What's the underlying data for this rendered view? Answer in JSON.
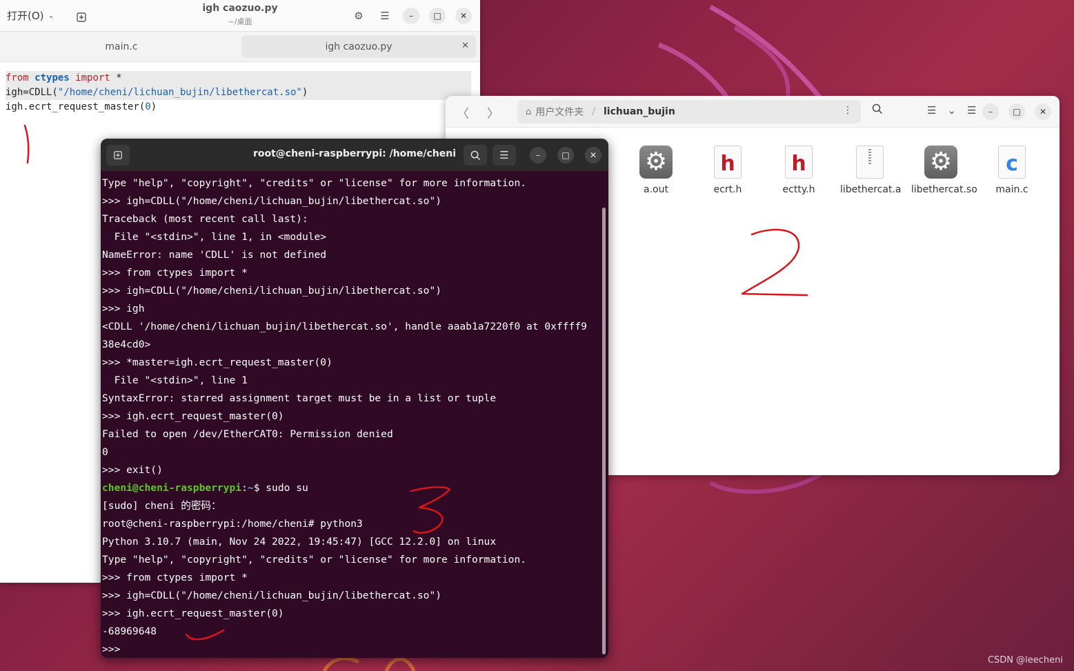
{
  "editor": {
    "open_menu_label": "打开(O)",
    "title": "igh caozuo.py",
    "subtitle": "~/桌面",
    "tabs": [
      {
        "label": "main.c"
      },
      {
        "label": "igh caozuo.py"
      }
    ],
    "code": {
      "line1": {
        "kw1": "from",
        "module": "ctypes",
        "kw2": "import",
        "rest": "*"
      },
      "line2": {
        "pre": "igh=CDLL(",
        "string": "\"/home/cheni/lichuan_bujin/libethercat.so\"",
        "post": ")"
      },
      "line3": {
        "pre": "igh.ecrt_request_master(",
        "num": "0",
        "post": ")"
      }
    }
  },
  "files": {
    "path_home": "用户文件夹",
    "path_current": "lichuan_bujin",
    "items": [
      {
        "name": "a.out",
        "icon": "executable-gear-icon"
      },
      {
        "name": "ecrt.h",
        "icon": "header-h-icon"
      },
      {
        "name": "ectty.h",
        "icon": "header-h-icon"
      },
      {
        "name": "libethercat.a",
        "icon": "archive-zip-icon"
      },
      {
        "name": "libethercat.so",
        "icon": "shared-library-gear-icon"
      },
      {
        "name": "main.c",
        "icon": "c-source-icon"
      }
    ],
    "item_letters": {
      "h": "h",
      "c": "c"
    }
  },
  "terminal": {
    "title": "root@cheni-raspberrypi: /home/cheni",
    "lines": [
      "Type \"help\", \"copyright\", \"credits\" or \"license\" for more information.",
      ">>> igh=CDLL(\"/home/cheni/lichuan_bujin/libethercat.so\")",
      "Traceback (most recent call last):",
      "  File \"<stdin>\", line 1, in <module>",
      "NameError: name 'CDLL' is not defined",
      ">>> from ctypes import *",
      ">>> igh=CDLL(\"/home/cheni/lichuan_bujin/libethercat.so\")",
      ">>> igh",
      "<CDLL '/home/cheni/lichuan_bujin/libethercat.so', handle aaab1a7220f0 at 0xffff9",
      "38e4cd0>",
      ">>> *master=igh.ecrt_request_master(0)",
      "  File \"<stdin>\", line 1",
      "SyntaxError: starred assignment target must be in a list or tuple",
      ">>> igh.ecrt_request_master(0)",
      "Failed to open /dev/EtherCAT0: Permission denied",
      "0",
      ">>> exit()"
    ],
    "prompt_user": "cheni@cheni-raspberrypi",
    "prompt_sep": ":",
    "prompt_path": "~",
    "prompt_cmd": "$ sudo su",
    "lines2": [
      "[sudo] cheni 的密码：",
      "root@cheni-raspberrypi:/home/cheni# python3",
      "Python 3.10.7 (main, Nov 24 2022, 19:45:47) [GCC 12.2.0] on linux",
      "Type \"help\", \"copyright\", \"credits\" or \"license\" for more information.",
      ">>> from ctypes import *",
      ">>> igh=CDLL(\"/home/cheni/lichuan_bujin/libethercat.so\")",
      ">>> igh.ecrt_request_master(0)",
      "-68969648",
      ">>> "
    ]
  },
  "watermark": "CSDN @leecheni",
  "colors": {
    "terminal_bg": "#300a24",
    "annotation": "#d9141b"
  }
}
